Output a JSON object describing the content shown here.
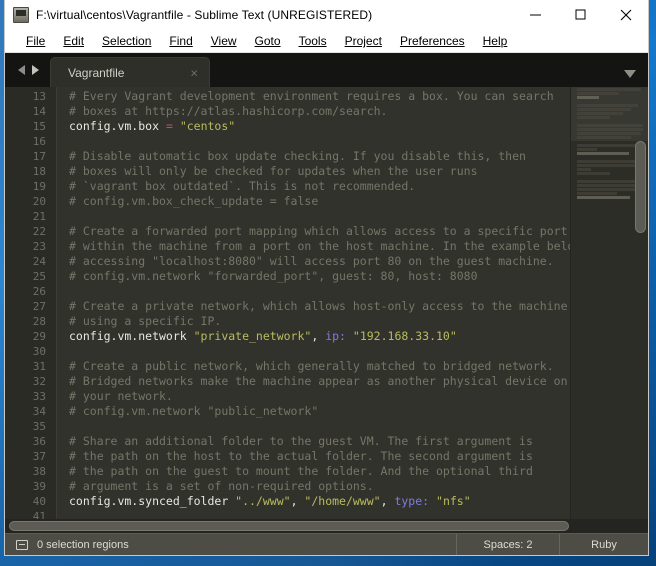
{
  "window": {
    "title": "F:\\virtual\\centos\\Vagrantfile - Sublime Text (UNREGISTERED)",
    "icon": "sublime-text-icon",
    "minimize_label": "—",
    "maximize_label": "□",
    "close_label": "✕"
  },
  "menubar": {
    "items": [
      {
        "label": "File"
      },
      {
        "label": "Edit"
      },
      {
        "label": "Selection"
      },
      {
        "label": "Find"
      },
      {
        "label": "View"
      },
      {
        "label": "Goto"
      },
      {
        "label": "Tools"
      },
      {
        "label": "Project"
      },
      {
        "label": "Preferences"
      },
      {
        "label": "Help"
      }
    ]
  },
  "tabbar": {
    "prev_icon": "arrow-left-icon",
    "next_icon": "arrow-right-icon",
    "tabs": [
      {
        "label": "Vagrantfile",
        "close_label": "×",
        "active": true
      }
    ],
    "menu_icon": "chevron-down-icon"
  },
  "editor": {
    "first_line_number": 13,
    "lines": [
      {
        "n": 13,
        "tokens": [
          {
            "t": "# Every Vagrant development environment requires a box. You can search",
            "c": "cm"
          }
        ]
      },
      {
        "n": 14,
        "tokens": [
          {
            "t": "# boxes at https://atlas.hashicorp.com/search.",
            "c": "cm"
          }
        ]
      },
      {
        "n": 15,
        "tokens": [
          {
            "t": "config.vm.box ",
            "c": "pl"
          },
          {
            "t": "=",
            "c": "op"
          },
          {
            "t": " ",
            "c": "pl"
          },
          {
            "t": "\"centos\"",
            "c": "st"
          }
        ]
      },
      {
        "n": 16,
        "tokens": []
      },
      {
        "n": 17,
        "tokens": [
          {
            "t": "# Disable automatic box update checking. If you disable this, then",
            "c": "cm"
          }
        ]
      },
      {
        "n": 18,
        "tokens": [
          {
            "t": "# boxes will only be checked for updates when the user runs",
            "c": "cm"
          }
        ]
      },
      {
        "n": 19,
        "tokens": [
          {
            "t": "# `vagrant box outdated`. This is not recommended.",
            "c": "cm"
          }
        ]
      },
      {
        "n": 20,
        "tokens": [
          {
            "t": "# config.vm.box_check_update = false",
            "c": "cm"
          }
        ]
      },
      {
        "n": 21,
        "tokens": []
      },
      {
        "n": 22,
        "tokens": [
          {
            "t": "# Create a forwarded port mapping which allows access to a specific port",
            "c": "cm"
          }
        ]
      },
      {
        "n": 23,
        "tokens": [
          {
            "t": "# within the machine from a port on the host machine. In the example below,",
            "c": "cm"
          }
        ]
      },
      {
        "n": 24,
        "tokens": [
          {
            "t": "# accessing \"localhost:8080\" will access port 80 on the guest machine.",
            "c": "cm"
          }
        ]
      },
      {
        "n": 25,
        "tokens": [
          {
            "t": "# config.vm.network \"forwarded_port\", guest: 80, host: 8080",
            "c": "cm"
          }
        ]
      },
      {
        "n": 26,
        "tokens": []
      },
      {
        "n": 27,
        "tokens": [
          {
            "t": "# Create a private network, which allows host-only access to the machine",
            "c": "cm"
          }
        ]
      },
      {
        "n": 28,
        "tokens": [
          {
            "t": "# using a specific IP.",
            "c": "cm"
          }
        ]
      },
      {
        "n": 29,
        "tokens": [
          {
            "t": "config.vm.network ",
            "c": "pl"
          },
          {
            "t": "\"private_network\"",
            "c": "st"
          },
          {
            "t": ", ",
            "c": "pl"
          },
          {
            "t": "ip:",
            "c": "kw"
          },
          {
            "t": " ",
            "c": "pl"
          },
          {
            "t": "\"192.168.33.10\"",
            "c": "st"
          }
        ]
      },
      {
        "n": 30,
        "tokens": []
      },
      {
        "n": 31,
        "tokens": [
          {
            "t": "# Create a public network, which generally matched to bridged network.",
            "c": "cm"
          }
        ]
      },
      {
        "n": 32,
        "tokens": [
          {
            "t": "# Bridged networks make the machine appear as another physical device on",
            "c": "cm"
          }
        ]
      },
      {
        "n": 33,
        "tokens": [
          {
            "t": "# your network.",
            "c": "cm"
          }
        ]
      },
      {
        "n": 34,
        "tokens": [
          {
            "t": "# config.vm.network \"public_network\"",
            "c": "cm"
          }
        ]
      },
      {
        "n": 35,
        "tokens": []
      },
      {
        "n": 36,
        "tokens": [
          {
            "t": "# Share an additional folder to the guest VM. The first argument is",
            "c": "cm"
          }
        ]
      },
      {
        "n": 37,
        "tokens": [
          {
            "t": "# the path on the host to the actual folder. The second argument is",
            "c": "cm"
          }
        ]
      },
      {
        "n": 38,
        "tokens": [
          {
            "t": "# the path on the guest to mount the folder. And the optional third",
            "c": "cm"
          }
        ]
      },
      {
        "n": 39,
        "tokens": [
          {
            "t": "# argument is a set of non-required options.",
            "c": "cm"
          }
        ]
      },
      {
        "n": 40,
        "tokens": [
          {
            "t": "config.vm.synced_folder ",
            "c": "pl"
          },
          {
            "t": "\"../www\"",
            "c": "st"
          },
          {
            "t": ", ",
            "c": "pl"
          },
          {
            "t": "\"/home/www\"",
            "c": "st"
          },
          {
            "t": ", ",
            "c": "pl"
          },
          {
            "t": "type:",
            "c": "kw"
          },
          {
            "t": " ",
            "c": "pl"
          },
          {
            "t": "\"nfs\"",
            "c": "st"
          }
        ]
      },
      {
        "n": 41,
        "tokens": []
      }
    ],
    "colors": {
      "background": "#32322c",
      "gutter": "#2b2b26",
      "comment": "#757568",
      "plain": "#e8e8e0",
      "string": "#b9bc5e",
      "operator": "#d2416b",
      "keyword": "#7d7ce0",
      "line_number": "#6f6f67"
    }
  },
  "statusbar": {
    "icon": "panel-toggle-icon",
    "selection_text": "0 selection regions",
    "indent": "Spaces: 2",
    "syntax": "Ruby"
  }
}
